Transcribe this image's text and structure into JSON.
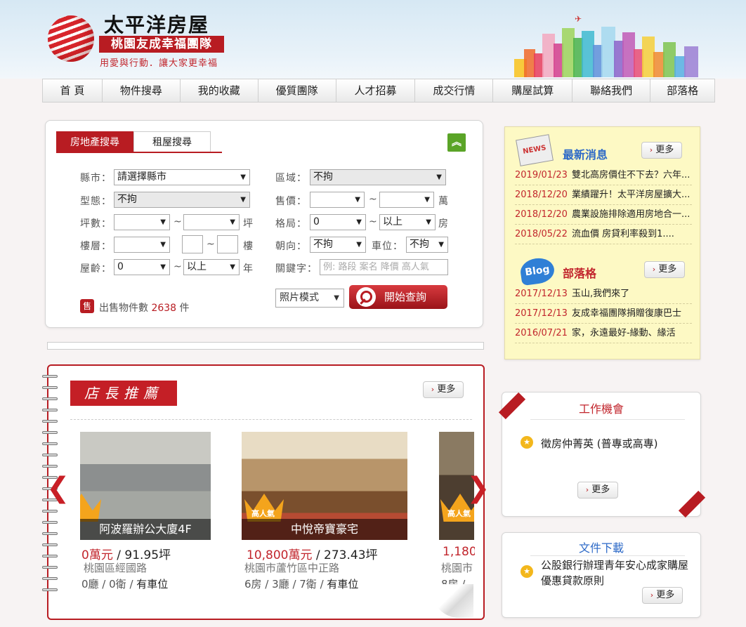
{
  "brand": {
    "title": "太平洋房屋",
    "team": "桃園友成幸福團隊",
    "slogan": "用愛與行動．讓大家更幸福"
  },
  "nav": [
    "首 頁",
    "物件搜尋",
    "我的收藏",
    "優質團隊",
    "人才招募",
    "成交行情",
    "購屋試算",
    "聯絡我們",
    "部落格"
  ],
  "search": {
    "tabs": [
      "房地產搜尋",
      "租屋搜尋"
    ],
    "county_label": "縣市：",
    "county_value": "請選擇縣市",
    "area_label": "區域：",
    "area_value": "不拘",
    "type_label": "型態：",
    "type_value": "不拘",
    "price_label": "售價：",
    "price_unit": "萬",
    "ping_label": "坪數：",
    "ping_unit": "坪",
    "layout_label": "格局：",
    "layout_from": "0",
    "layout_to": "以上",
    "layout_unit": "房",
    "floor_label": "樓層：",
    "floor_unit": "樓",
    "facing_label": "朝向：",
    "facing_value": "不拘",
    "parking_label": "車位：",
    "parking_value": "不拘",
    "age_label": "屋齡：",
    "age_from": "0",
    "age_to": "以上",
    "age_unit": "年",
    "keyword_label": "關鍵字：",
    "keyword_placeholder": "例: 路段 案名 降價 高人氣",
    "tilde": "~",
    "sale_badge": "售",
    "sale_prefix": "出售物件數",
    "sale_count": "2638",
    "sale_suffix": "件",
    "view_mode": "照片模式",
    "submit": "開始查詢"
  },
  "news": {
    "title": "最新消息",
    "icon_text": "NEWS",
    "more": "更多",
    "items": [
      {
        "date": "2019/01/23",
        "text": "雙北高房價住不下去？六年..."
      },
      {
        "date": "2018/12/20",
        "text": "業績躍升！太平洋房屋擴大..."
      },
      {
        "date": "2018/12/20",
        "text": "農業設施排除適用房地合一..."
      },
      {
        "date": "2018/05/22",
        "text": "流血價 房貸利率殺到1...."
      }
    ]
  },
  "blog": {
    "title": "部落格",
    "icon_text": "Blog",
    "more": "更多",
    "items": [
      {
        "date": "2017/12/13",
        "text": "玉山,我們來了"
      },
      {
        "date": "2017/12/13",
        "text": "友成幸福團隊捐贈復康巴士"
      },
      {
        "date": "2016/07/21",
        "text": "家，永遠最好-緣動、緣活"
      }
    ]
  },
  "recommend": {
    "title": "店長推薦",
    "more": "更多",
    "cards": [
      {
        "name": "阿波羅辦公大廈4F",
        "price": "0萬元",
        "area": "91.95坪",
        "addr": "桃園區經國路",
        "rooms": "0廳 / 0衛 / ",
        "parking": "有車位"
      },
      {
        "name": "中悅帝寶豪宅",
        "price": "10,800萬元",
        "area": "273.43坪",
        "addr": "桃園市蘆竹區中正路",
        "rooms": "6房 / 3廳 / 7衛 / ",
        "parking": "有車位",
        "badge": "高人氣"
      },
      {
        "name": "",
        "price": "1,180",
        "area": "",
        "addr": "桃園市",
        "rooms": "8房 / ",
        "parking": "",
        "badge": "高人氣"
      }
    ],
    "slash": " / "
  },
  "jobs": {
    "title": "工作機會",
    "item": "徵房仲菁英 (普專或高專)",
    "more": "更多"
  },
  "docs": {
    "title": "文件下載",
    "item": "公股銀行辦理青年安心成家購屋優惠貸款原則",
    "more": "更多"
  },
  "colors": {
    "brand_red": "#b81c22",
    "link_blue": "#2c69c7",
    "note_yellow": "#fdf9c4"
  }
}
